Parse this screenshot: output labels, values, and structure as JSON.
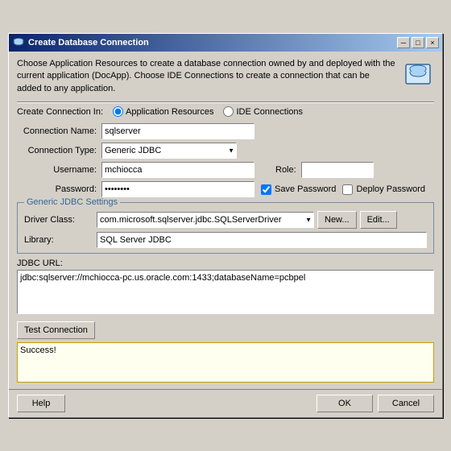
{
  "window": {
    "title": "Create Database Connection",
    "close_label": "×",
    "minimize_label": "─",
    "maximize_label": "□"
  },
  "header": {
    "description": "Choose Application Resources to create a database connection owned by and deployed with the current application (DocApp). Choose IDE Connections to create a connection that can be added to any application."
  },
  "radio_group": {
    "label": "Create Connection In:",
    "options": [
      "Application Resources",
      "IDE Connections"
    ],
    "selected": "Application Resources"
  },
  "form": {
    "connection_name_label": "Connection Name:",
    "connection_name_value": "sqlserver",
    "connection_type_label": "Connection Type:",
    "connection_type_value": "Generic JDBC",
    "username_label": "Username:",
    "username_value": "mchiocca",
    "password_label": "Password:",
    "password_value": "•••••••",
    "role_label": "Role:",
    "role_value": "",
    "save_password_label": "Save Password",
    "save_password_checked": true,
    "deploy_password_label": "Deploy Password",
    "deploy_password_checked": false
  },
  "jdbc_section": {
    "title": "Generic JDBC Settings",
    "driver_class_label": "Driver Class:",
    "driver_class_value": "com.microsoft.sqlserver.jdbc.SQLServerDriver",
    "library_label": "Library:",
    "library_value": "SQL Server JDBC",
    "new_btn": "New...",
    "edit_btn": "Edit...",
    "jdbc_url_label": "JDBC URL:",
    "jdbc_url_value": "jdbc:sqlserver://mchiocca-pc.us.oracle.com:1433;databaseName=pcbpel"
  },
  "test_connection": {
    "button_label": "Test Connection",
    "result_text": "Success!"
  },
  "bottom": {
    "help_label": "Help",
    "ok_label": "OK",
    "cancel_label": "Cancel"
  }
}
